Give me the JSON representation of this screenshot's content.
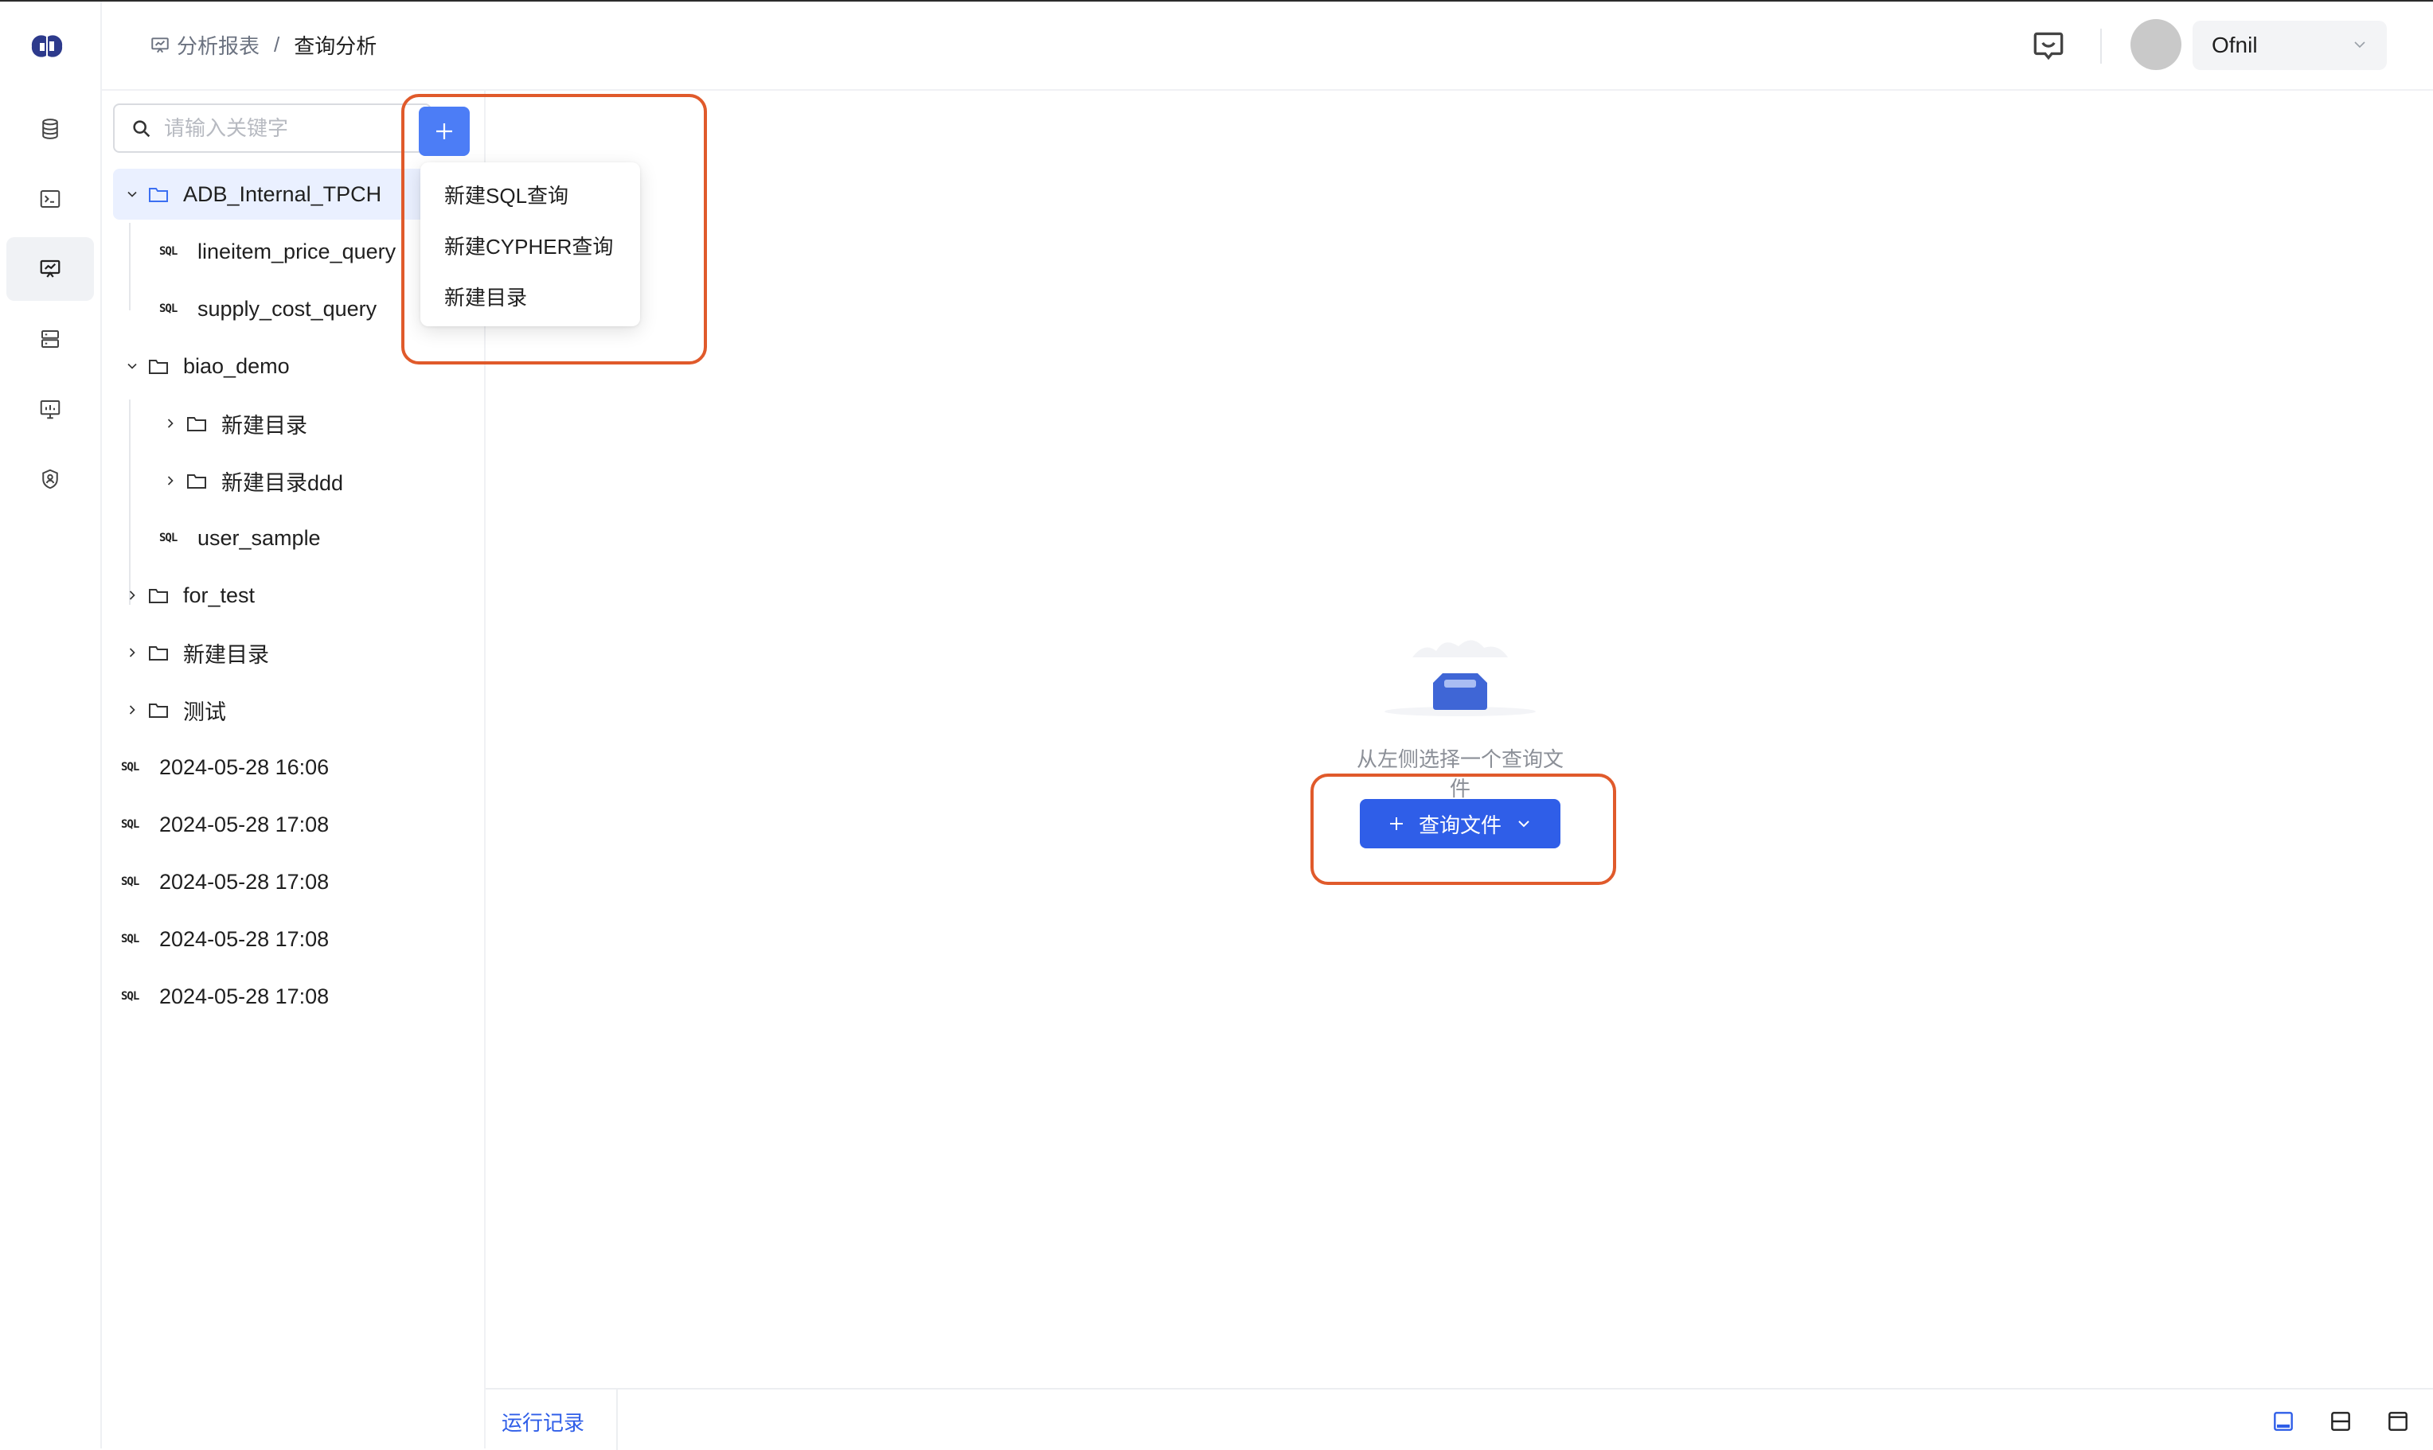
{
  "header": {
    "breadcrumb_parent": "分析报表",
    "breadcrumb_separator": "/",
    "breadcrumb_current": "查询分析",
    "username": "Ofnil"
  },
  "rail": {
    "items": [
      {
        "icon": "database-icon"
      },
      {
        "icon": "terminal-icon"
      },
      {
        "icon": "analysis-report-icon",
        "active": true
      },
      {
        "icon": "server-icon"
      },
      {
        "icon": "monitor-chart-icon"
      },
      {
        "icon": "shield-user-icon"
      }
    ]
  },
  "sidebar": {
    "search_placeholder": "请输入关键字",
    "tree": [
      {
        "label": "ADB_Internal_TPCH",
        "type": "folder",
        "expanded": true,
        "selected": true
      },
      {
        "label": "lineitem_price_query",
        "type": "sql",
        "badge": "SQL"
      },
      {
        "label": "supply_cost_query",
        "type": "sql",
        "badge": "SQL"
      },
      {
        "label": "biao_demo",
        "type": "folder",
        "expanded": true
      },
      {
        "label": "新建目录",
        "type": "folder",
        "expanded": false
      },
      {
        "label": "新建目录ddd",
        "type": "folder",
        "expanded": false
      },
      {
        "label": "user_sample",
        "type": "sql",
        "badge": "SQL"
      },
      {
        "label": "for_test",
        "type": "folder",
        "expanded": false
      },
      {
        "label": "新建目录",
        "type": "folder",
        "expanded": false
      },
      {
        "label": "测试",
        "type": "folder",
        "expanded": false
      },
      {
        "label": "2024-05-28 16:06",
        "type": "sql",
        "badge": "SQL"
      },
      {
        "label": "2024-05-28 17:08",
        "type": "sql",
        "badge": "SQL"
      },
      {
        "label": "2024-05-28 17:08",
        "type": "sql",
        "badge": "SQL"
      },
      {
        "label": "2024-05-28 17:08",
        "type": "sql",
        "badge": "SQL"
      },
      {
        "label": "2024-05-28 17:08",
        "type": "sql",
        "badge": "SQL"
      }
    ]
  },
  "dropdown": {
    "items": [
      "新建SQL查询",
      "新建CYPHER查询",
      "新建目录"
    ]
  },
  "main": {
    "empty_text": "从左侧选择一个查询文件",
    "query_button": "查询文件"
  },
  "footer": {
    "run_log": "运行记录"
  },
  "colors": {
    "accent": "#2f5ee8",
    "add_button": "#4c7df6",
    "highlight": "#e05a2b",
    "selected_row": "#eaf0ff"
  }
}
